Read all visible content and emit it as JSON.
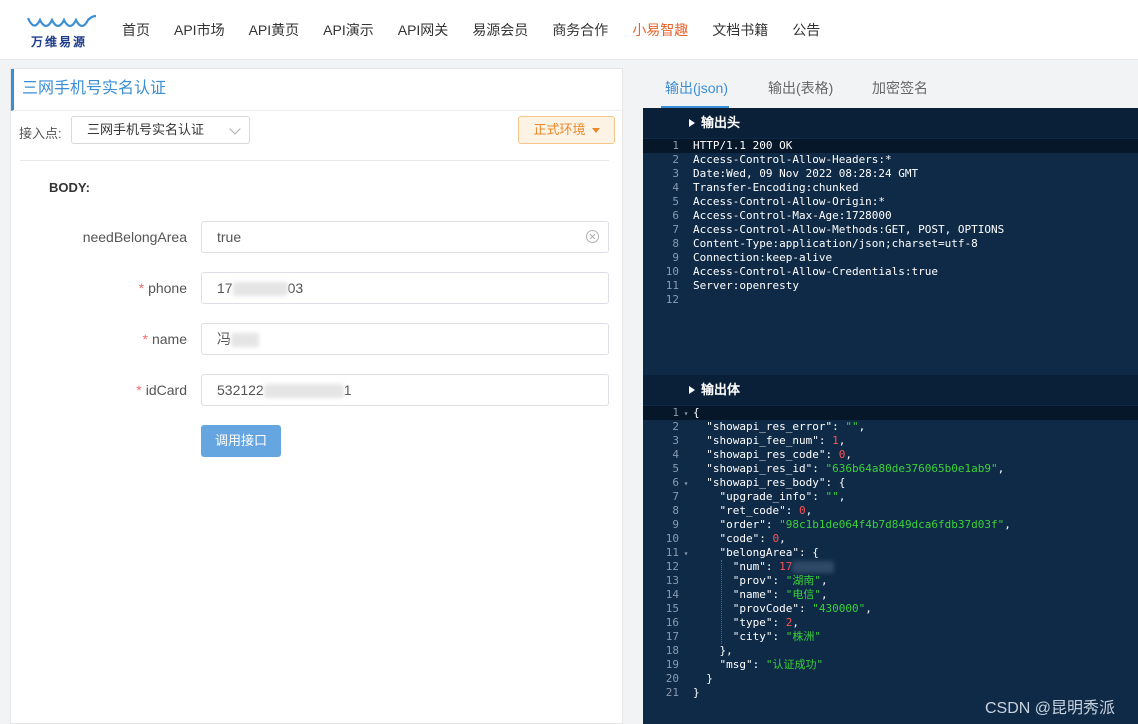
{
  "logo": {
    "text": "万维易源"
  },
  "nav": [
    {
      "label": "首页",
      "highlight": false
    },
    {
      "label": "API市场",
      "highlight": false
    },
    {
      "label": "API黄页",
      "highlight": false
    },
    {
      "label": "API演示",
      "highlight": false
    },
    {
      "label": "API网关",
      "highlight": false
    },
    {
      "label": "易源会员",
      "highlight": false
    },
    {
      "label": "商务合作",
      "highlight": false
    },
    {
      "label": "小易智趣",
      "highlight": true
    },
    {
      "label": "文档书籍",
      "highlight": false
    },
    {
      "label": "公告",
      "highlight": false
    }
  ],
  "left": {
    "title": "三网手机号实名认证",
    "entry_label": "接入点:",
    "entry_value": "三网手机号实名认证",
    "env_button": "正式环境",
    "body_label": "BODY:",
    "fields": [
      {
        "label": "needBelongArea",
        "required": false,
        "value": "true"
      },
      {
        "label": "phone",
        "required": true,
        "value_prefix": "17",
        "value_suffix": "03"
      },
      {
        "label": "name",
        "required": true,
        "value_prefix": "冯",
        "value_suffix": ""
      },
      {
        "label": "idCard",
        "required": true,
        "value_prefix": "532122",
        "value_suffix": "1"
      }
    ],
    "call_button": "调用接口"
  },
  "right": {
    "tabs": [
      {
        "label": "输出(json)",
        "active": true
      },
      {
        "label": "输出(表格)",
        "active": false
      },
      {
        "label": "加密签名",
        "active": false
      }
    ],
    "header_section": "输出头",
    "header_lines": [
      "HTTP/1.1 200 OK",
      "Access-Control-Allow-Headers:*",
      "Date:Wed, 09 Nov 2022 08:28:24 GMT",
      "Transfer-Encoding:chunked",
      "Access-Control-Allow-Origin:*",
      "Access-Control-Max-Age:1728000",
      "Access-Control-Allow-Methods:GET, POST, OPTIONS",
      "Content-Type:application/json;charset=utf-8",
      "Connection:keep-alive",
      "Access-Control-Allow-Credentials:true",
      "Server:openresty",
      ""
    ],
    "body_section": "输出体",
    "body_lines": [
      {
        "fold": true,
        "parts": [
          [
            "p",
            "{"
          ]
        ]
      },
      {
        "fold": false,
        "parts": [
          [
            "p",
            "  "
          ],
          [
            "k",
            "\"showapi_res_error\""
          ],
          [
            "p",
            ": "
          ],
          [
            "s",
            "\"\""
          ],
          [
            "p",
            ","
          ]
        ]
      },
      {
        "fold": false,
        "parts": [
          [
            "p",
            "  "
          ],
          [
            "k",
            "\"showapi_fee_num\""
          ],
          [
            "p",
            ": "
          ],
          [
            "n",
            "1"
          ],
          [
            "p",
            ","
          ]
        ]
      },
      {
        "fold": false,
        "parts": [
          [
            "p",
            "  "
          ],
          [
            "k",
            "\"showapi_res_code\""
          ],
          [
            "p",
            ": "
          ],
          [
            "n",
            "0"
          ],
          [
            "p",
            ","
          ]
        ]
      },
      {
        "fold": false,
        "parts": [
          [
            "p",
            "  "
          ],
          [
            "k",
            "\"showapi_res_id\""
          ],
          [
            "p",
            ": "
          ],
          [
            "s",
            "\"636b64a80de376065b0e1ab9\""
          ],
          [
            "p",
            ","
          ]
        ]
      },
      {
        "fold": true,
        "parts": [
          [
            "p",
            "  "
          ],
          [
            "k",
            "\"showapi_res_body\""
          ],
          [
            "p",
            ": {"
          ]
        ]
      },
      {
        "fold": false,
        "parts": [
          [
            "p",
            "    "
          ],
          [
            "k",
            "\"upgrade_info\""
          ],
          [
            "p",
            ": "
          ],
          [
            "s",
            "\"\""
          ],
          [
            "p",
            ","
          ]
        ]
      },
      {
        "fold": false,
        "parts": [
          [
            "p",
            "    "
          ],
          [
            "k",
            "\"ret_code\""
          ],
          [
            "p",
            ": "
          ],
          [
            "n",
            "0"
          ],
          [
            "p",
            ","
          ]
        ]
      },
      {
        "fold": false,
        "parts": [
          [
            "p",
            "    "
          ],
          [
            "k",
            "\"order\""
          ],
          [
            "p",
            ": "
          ],
          [
            "s",
            "\"98c1b1de064f4b7d849dca6fdb37d03f\""
          ],
          [
            "p",
            ","
          ]
        ]
      },
      {
        "fold": false,
        "parts": [
          [
            "p",
            "    "
          ],
          [
            "k",
            "\"code\""
          ],
          [
            "p",
            ": "
          ],
          [
            "n",
            "0"
          ],
          [
            "p",
            ","
          ]
        ]
      },
      {
        "fold": true,
        "parts": [
          [
            "p",
            "    "
          ],
          [
            "k",
            "\"belongArea\""
          ],
          [
            "p",
            ": {"
          ]
        ]
      },
      {
        "fold": false,
        "parts": [
          [
            "p",
            "      "
          ],
          [
            "k",
            "\"num\""
          ],
          [
            "p",
            ": "
          ],
          [
            "n",
            "17"
          ],
          [
            "blur",
            ""
          ]
        ]
      },
      {
        "fold": false,
        "parts": [
          [
            "p",
            "      "
          ],
          [
            "k",
            "\"prov\""
          ],
          [
            "p",
            ": "
          ],
          [
            "s",
            "\"湖南\""
          ],
          [
            "p",
            ","
          ]
        ]
      },
      {
        "fold": false,
        "parts": [
          [
            "p",
            "      "
          ],
          [
            "k",
            "\"name\""
          ],
          [
            "p",
            ": "
          ],
          [
            "s",
            "\"电信\""
          ],
          [
            "p",
            ","
          ]
        ]
      },
      {
        "fold": false,
        "parts": [
          [
            "p",
            "      "
          ],
          [
            "k",
            "\"provCode\""
          ],
          [
            "p",
            ": "
          ],
          [
            "s",
            "\"430000\""
          ],
          [
            "p",
            ","
          ]
        ]
      },
      {
        "fold": false,
        "parts": [
          [
            "p",
            "      "
          ],
          [
            "k",
            "\"type\""
          ],
          [
            "p",
            ": "
          ],
          [
            "n",
            "2"
          ],
          [
            "p",
            ","
          ]
        ]
      },
      {
        "fold": false,
        "parts": [
          [
            "p",
            "      "
          ],
          [
            "k",
            "\"city\""
          ],
          [
            "p",
            ": "
          ],
          [
            "s",
            "\"株洲\""
          ]
        ]
      },
      {
        "fold": false,
        "parts": [
          [
            "p",
            "    },"
          ]
        ]
      },
      {
        "fold": false,
        "parts": [
          [
            "p",
            "    "
          ],
          [
            "k",
            "\"msg\""
          ],
          [
            "p",
            ": "
          ],
          [
            "s",
            "\"认证成功\""
          ]
        ]
      },
      {
        "fold": false,
        "parts": [
          [
            "p",
            "  }"
          ]
        ]
      },
      {
        "fold": false,
        "parts": [
          [
            "p",
            "}"
          ]
        ]
      }
    ]
  },
  "watermark": "CSDN @昆明秀派"
}
